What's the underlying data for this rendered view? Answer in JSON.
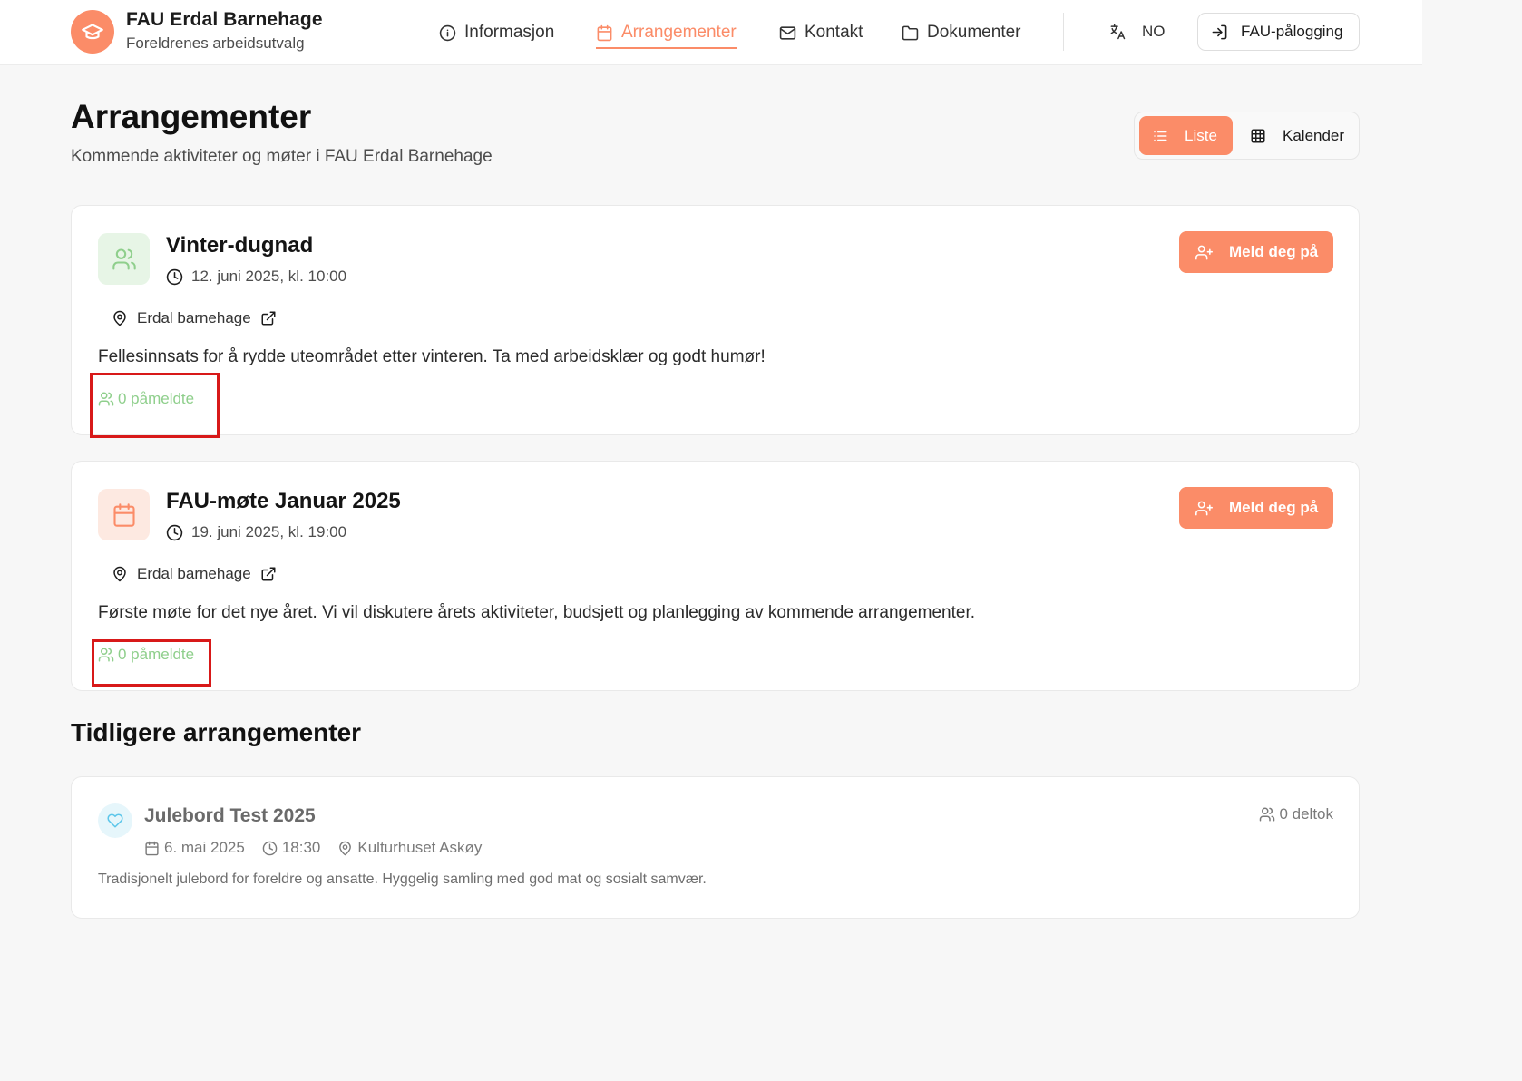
{
  "header": {
    "brand_title": "FAU Erdal Barnehage",
    "brand_subtitle": "Foreldrenes arbeidsutvalg",
    "nav": [
      {
        "label": "Informasjon",
        "icon": "info-icon"
      },
      {
        "label": "Arrangementer",
        "icon": "calendar-icon",
        "active": true
      },
      {
        "label": "Kontakt",
        "icon": "mail-icon"
      },
      {
        "label": "Dokumenter",
        "icon": "folder-icon"
      }
    ],
    "language": "NO",
    "login_label": "FAU-pålogging"
  },
  "page": {
    "title": "Arrangementer",
    "subtitle": "Kommende aktiviteter og møter i FAU Erdal Barnehage",
    "view_toggle": {
      "list_label": "Liste",
      "calendar_label": "Kalender",
      "selected": "Liste"
    }
  },
  "events": [
    {
      "title": "Vinter-dugnad",
      "datetime": "12. juni 2025, kl. 10:00",
      "location": "Erdal barnehage",
      "description": "Fellesinnsats for å rydde uteområdet etter vinteren. Ta med arbeidsklær og godt humør!",
      "count": "0 påmeldte",
      "signup_label": "Meld deg på",
      "icon": "users-icon"
    },
    {
      "title": "FAU-møte Januar 2025",
      "datetime": "19. juni 2025, kl. 19:00",
      "location": "Erdal barnehage",
      "description": "Første møte for det nye året. Vi vil diskutere årets aktiviteter, budsjett og planlegging av kommende arrangementer.",
      "count": "0 påmeldte",
      "signup_label": "Meld deg på",
      "icon": "calendar-icon"
    }
  ],
  "past_section": {
    "title": "Tidligere arrangementer",
    "events": [
      {
        "title": "Julebord Test 2025",
        "date": "6. mai 2025",
        "time": "18:30",
        "location": "Kulturhuset Askøy",
        "description": "Tradisjonelt julebord for foreldre og ansatte. Hyggelig samling med god mat og sosialt samvær.",
        "count": "0 deltok",
        "icon": "heart-icon"
      }
    ]
  },
  "colors": {
    "accent": "#fb8c68",
    "count_green": "#8fcf8c",
    "highlight_red": "#d81919"
  }
}
